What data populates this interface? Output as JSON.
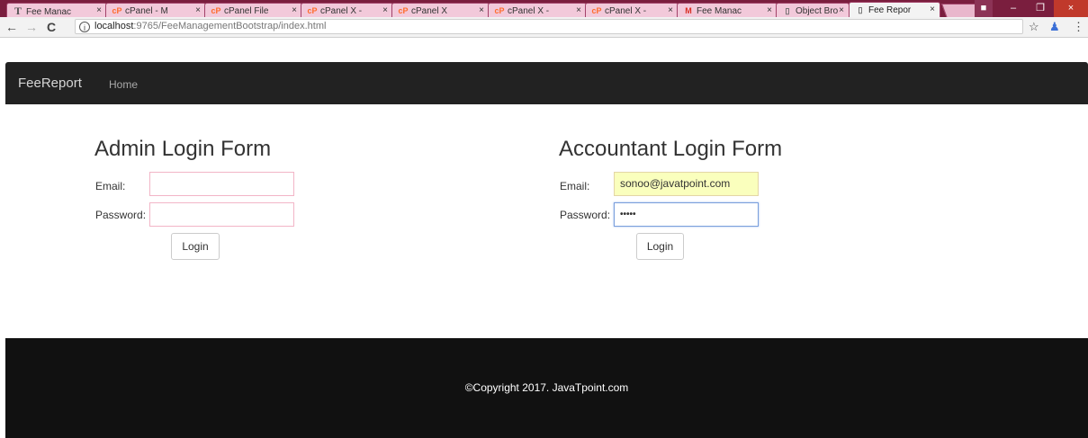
{
  "browser": {
    "tabs": [
      {
        "label": "Fee Manac",
        "icon": "t"
      },
      {
        "label": "cPanel - M",
        "icon": "cp"
      },
      {
        "label": "cPanel File",
        "icon": "cp"
      },
      {
        "label": "cPanel X -",
        "icon": "cp"
      },
      {
        "label": "cPanel X",
        "icon": "cp"
      },
      {
        "label": "cPanel X -",
        "icon": "cp"
      },
      {
        "label": "cPanel X -",
        "icon": "cp"
      },
      {
        "label": "Fee Manac",
        "icon": "gmail"
      },
      {
        "label": "Object Bro",
        "icon": "doc"
      },
      {
        "label": "Fee Repor",
        "icon": "doc",
        "active": true
      }
    ],
    "tab_close": "×",
    "url_host": "localhost",
    "url_path": ":9765/FeeManagementBootstrap/index.html",
    "back": "←",
    "forward": "→",
    "reload": "C",
    "info": "i",
    "star": "☆",
    "menu": "⋮",
    "minimize": "–",
    "restore": "❐",
    "close": "×"
  },
  "navbar": {
    "brand": "FeeReport",
    "home": "Home"
  },
  "admin": {
    "title": "Admin Login Form",
    "email_label": "Email:",
    "email_value": "",
    "password_label": "Password:",
    "password_value": "",
    "button": "Login"
  },
  "accountant": {
    "title": "Accountant Login Form",
    "email_label": "Email:",
    "email_value": "sonoo@javatpoint.com",
    "password_label": "Password:",
    "password_value": "•••••",
    "button": "Login"
  },
  "footer": {
    "copyright": "©Copyright 2017. JavaTpoint.com"
  }
}
